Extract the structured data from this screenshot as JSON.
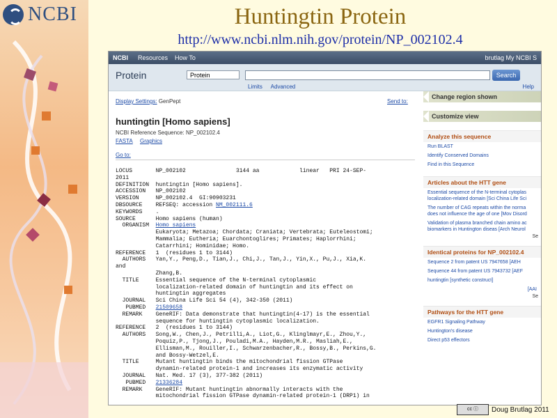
{
  "slide": {
    "logo_text": "NCBI",
    "title": "Huntingtin Protein",
    "url": "http://www.ncbi.nlm.nih.gov/protein/NP_002102.4",
    "credit": "Doug Brutlag 2011"
  },
  "topbar": {
    "logo": "NCBI",
    "resources": "Resources",
    "howto": "How To",
    "user": "brutlag  My NCBI  S"
  },
  "search": {
    "db_title": "Protein",
    "db_select": "Protein",
    "query": "",
    "button": "Search",
    "limits": "Limits",
    "advanced": "Advanced",
    "help": "Help"
  },
  "record": {
    "display_settings": "Display Settings:",
    "format": "GenPept",
    "send_to": "Send to:",
    "title": "huntingtin [Homo sapiens]",
    "refseq": "NCBI Reference Sequence: NP_002102.4",
    "fasta": "FASTA",
    "graphics": "Graphics",
    "goto": "Go to:",
    "lines": [
      [
        "LOCUS       NP_002102               3144 aa            linear   PRI 24-SEP-",
        ""
      ],
      [
        "2011",
        ""
      ],
      [
        "DEFINITION  huntingtin [Homo sapiens].",
        ""
      ],
      [
        "ACCESSION   NP_002102",
        ""
      ],
      [
        "VERSION     NP_002102.4  GI:90903231",
        ""
      ],
      [
        "DBSOURCE    REFSEQ: accession ",
        "NM_002111.6"
      ],
      [
        "KEYWORDS    .",
        ""
      ],
      [
        "SOURCE      Homo sapiens (human)",
        ""
      ],
      [
        "  ORGANISM  ",
        "Homo sapiens"
      ],
      [
        "            Eukaryota; Metazoa; Chordata; Craniata; Vertebrata; Euteleostomi;",
        ""
      ],
      [
        "            Mammalia; Eutheria; Euarchontoglires; Primates; Haplorrhini;",
        ""
      ],
      [
        "            Catarrhini; Hominidae; Homo.",
        ""
      ],
      [
        "REFERENCE   1  (residues 1 to 3144)",
        ""
      ],
      [
        "  AUTHORS   Yan,Y., Peng,D., Tian,J., Chi,J., Tan,J., Yin,X., Pu,J., Xia,K.",
        ""
      ],
      [
        "and",
        ""
      ],
      [
        "            Zhang,B.",
        ""
      ],
      [
        "  TITLE     Essential sequence of the N-terminal cytoplasmic",
        ""
      ],
      [
        "            localization-related domain of huntingtin and its effect on",
        ""
      ],
      [
        "            huntingtin aggregates",
        ""
      ],
      [
        "  JOURNAL   Sci China Life Sci 54 (4), 342-350 (2011)",
        ""
      ],
      [
        "   PUBMED   ",
        "21509658"
      ],
      [
        "  REMARK    GeneRIF: Data demonstrate that huntingtin(4-17) is the essential",
        ""
      ],
      [
        "            sequence for huntingtin cytoplasmic localization.",
        ""
      ],
      [
        "REFERENCE   2  (residues 1 to 3144)",
        ""
      ],
      [
        "  AUTHORS   Song,W., Chen,J., Petrilli,A., Liot,G., Klinglmayr,E., Zhou,Y.,",
        ""
      ],
      [
        "            Poquiz,P., Tjong,J., Pouladi,M.A., Hayden,M.R., Masliah,E.,",
        ""
      ],
      [
        "            Ellisman,M., Rouiller,I., Schwarzenbacher,R., Bossy,B., Perkins,G.",
        ""
      ],
      [
        "            and Bossy-Wetzel,E.",
        ""
      ],
      [
        "  TITLE     Mutant huntingtin binds the mitochondrial fission GTPase",
        ""
      ],
      [
        "            dynamin-related protein-1 and increases its enzymatic activity",
        ""
      ],
      [
        "  JOURNAL   Nat. Med. 17 (3), 377-382 (2011)",
        ""
      ],
      [
        "   PUBMED   ",
        "21336284"
      ],
      [
        "  REMARK    GeneRIF: Mutant huntingtin abnormally interacts with the",
        ""
      ],
      [
        "            mitochondrial fission GTPase dynamin-related protein-1 (DRP1) in",
        ""
      ]
    ]
  },
  "sidebar": {
    "change_region": "Change region shown",
    "customize": "Customize view",
    "analyze": {
      "title": "Analyze this sequence",
      "items": [
        "Run BLAST",
        "Identify Conserved Domains",
        "Find in this Sequence"
      ]
    },
    "articles": {
      "title": "Articles about the HTT gene",
      "items": [
        "Essential sequence of the N-terminal cytoplas localization-related domain [Sci China Life Sci",
        "The number of CAG repeats within the norma does not influence the age of one [Mov Disord",
        "Validation of plasma branched chain amino ac biomarkers in Huntington diseas [Arch Neurol"
      ],
      "see": "Se"
    },
    "identical": {
      "title": "Identical proteins for NP_002102.4",
      "items": [
        "Sequence 2 from patent US 7947658   [AEH",
        "Sequence 44 from patent US 7943732  [AEF",
        "huntingtin [synthetic construct]",
        "[AAI"
      ],
      "see": "Se"
    },
    "pathways": {
      "title": "Pathways for the HTT gene",
      "items": [
        "EGFR1 Signaling Pathway",
        "Huntington's disease",
        "Direct p53 effectors"
      ]
    }
  }
}
